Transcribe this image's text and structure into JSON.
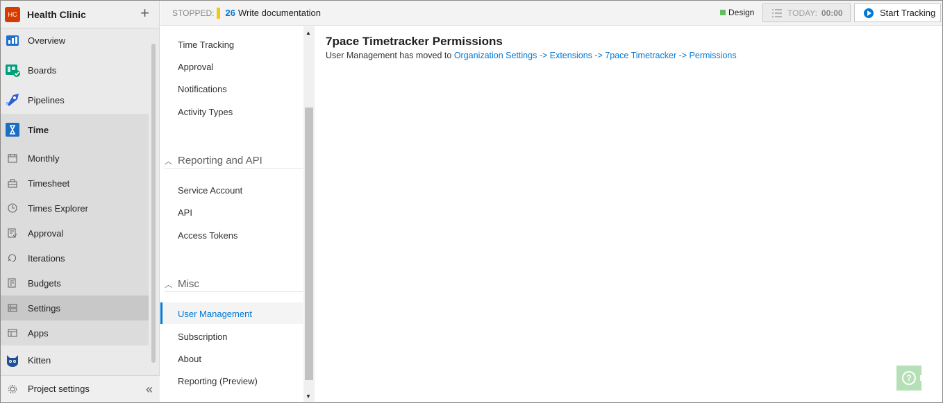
{
  "org": {
    "badge": "HC",
    "name": "Health Clinic"
  },
  "leftnav": {
    "items": [
      {
        "label": "Overview",
        "icon": "overview-icon"
      },
      {
        "label": "Boards",
        "icon": "boards-icon"
      },
      {
        "label": "Pipelines",
        "icon": "pipelines-icon"
      },
      {
        "label": "Time",
        "icon": "time-icon"
      },
      {
        "label": "Monthly",
        "icon": "calendar-icon"
      },
      {
        "label": "Timesheet",
        "icon": "timesheet-icon"
      },
      {
        "label": "Times Explorer",
        "icon": "clock-icon"
      },
      {
        "label": "Approval",
        "icon": "approval-icon"
      },
      {
        "label": "Iterations",
        "icon": "iterations-icon"
      },
      {
        "label": "Budgets",
        "icon": "budgets-icon"
      },
      {
        "label": "Settings",
        "icon": "settings-icon"
      },
      {
        "label": "Apps",
        "icon": "apps-icon"
      },
      {
        "label": "Kitten",
        "icon": "kitten-icon"
      }
    ],
    "footer": {
      "label": "Project settings"
    }
  },
  "topbar": {
    "status": "STOPPED:",
    "work_item_id": "26",
    "work_item_title": "Write documentation",
    "activity": "Design",
    "today_label": "TODAY:",
    "today_time": "00:00",
    "start_label": "Start Tracking"
  },
  "subnav": {
    "group1": [
      "Time Tracking",
      "Approval",
      "Notifications",
      "Activity Types"
    ],
    "section2": "Reporting and API",
    "group2": [
      "Service Account",
      "API",
      "Access Tokens"
    ],
    "section3": "Misc",
    "group3": [
      "User Management",
      "Subscription",
      "About",
      "Reporting (Preview)"
    ]
  },
  "main": {
    "title": "7pace Timetracker Permissions",
    "desc_prefix": "User Management has moved to ",
    "link": "Organization Settings -> Extensions -> 7pace Timetracker -> Permissions"
  },
  "colors": {
    "accent": "#0078d4",
    "org_badge": "#d83b01",
    "stopped_indicator": "#f2c811",
    "activity": "#60c060",
    "help": "#b5dfb6"
  }
}
